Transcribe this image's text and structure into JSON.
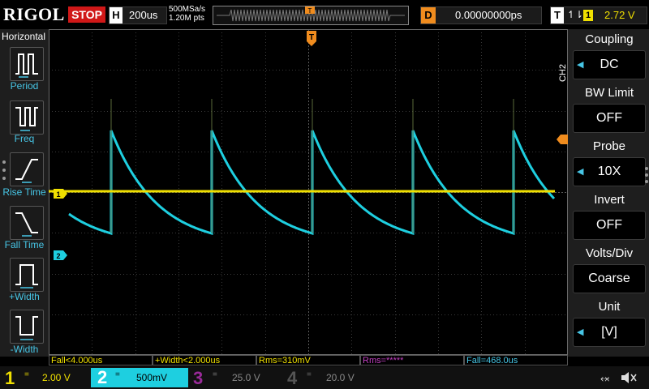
{
  "topbar": {
    "logo": "RIGOL",
    "run_state": "STOP",
    "h_label": "H",
    "timebase": "200us",
    "sample_rate": "500MSa/s",
    "memory": "1.20M pts",
    "d_label": "D",
    "delay": "0.00000000ps",
    "t_label": "T",
    "trigger_icon": "edge-trigger-icon",
    "trigger_channel": "1",
    "trigger_level": "2.72 V"
  },
  "left_menu": {
    "title": "Horizontal",
    "items": [
      {
        "label": "Period",
        "icon": "period-icon"
      },
      {
        "label": "Freq",
        "icon": "freq-icon"
      },
      {
        "label": "Rise Time",
        "icon": "rise-time-icon"
      },
      {
        "label": "Fall Time",
        "icon": "fall-time-icon"
      },
      {
        "label": "+Width",
        "icon": "pos-width-icon"
      },
      {
        "label": "-Width",
        "icon": "neg-width-icon"
      }
    ]
  },
  "right_menu": {
    "tab": "CH2",
    "items": [
      {
        "title": "Coupling",
        "value": "DC"
      },
      {
        "title": "BW Limit",
        "value": "OFF"
      },
      {
        "title": "Probe",
        "value": "10X"
      },
      {
        "title": "Invert",
        "value": "OFF"
      },
      {
        "title": "Volts/Div",
        "value": "Coarse"
      },
      {
        "title": "Unit",
        "value": "[V]"
      }
    ]
  },
  "markers": {
    "trigger_pos": "T",
    "ch1": "1",
    "ch2": "2"
  },
  "measurements": [
    {
      "text": "Fall<4.000us",
      "color": "#f0e000"
    },
    {
      "text": "+Width<2.000us",
      "color": "#f0e000"
    },
    {
      "text": "Rms=310mV",
      "color": "#f0e000"
    },
    {
      "text": "Rms=*****",
      "color": "#c040c0"
    },
    {
      "text": "Fall=468.0us",
      "color": "#47c6e6"
    }
  ],
  "channels": [
    {
      "num": "1",
      "coupling": "=",
      "scale": "2.00 V",
      "color": "#f0e000",
      "active": false
    },
    {
      "num": "2",
      "coupling": "=",
      "scale": "500mV",
      "color": "#47c6e6",
      "active": true
    },
    {
      "num": "3",
      "coupling": "=",
      "scale": "25.0 V",
      "color": "#9a2a9a",
      "active": false
    },
    {
      "num": "4",
      "coupling": "=",
      "scale": "20.0 V",
      "color": "#555555",
      "active": false
    }
  ],
  "status": {
    "usb_icon": "usb-icon",
    "speaker_icon": "speaker-muted-icon"
  },
  "colors": {
    "ch1": "#f0e000",
    "ch2": "#47c6e6",
    "trigger": "#f08c1e",
    "stop": "#d01818",
    "grid": "#3a3a3a"
  }
}
